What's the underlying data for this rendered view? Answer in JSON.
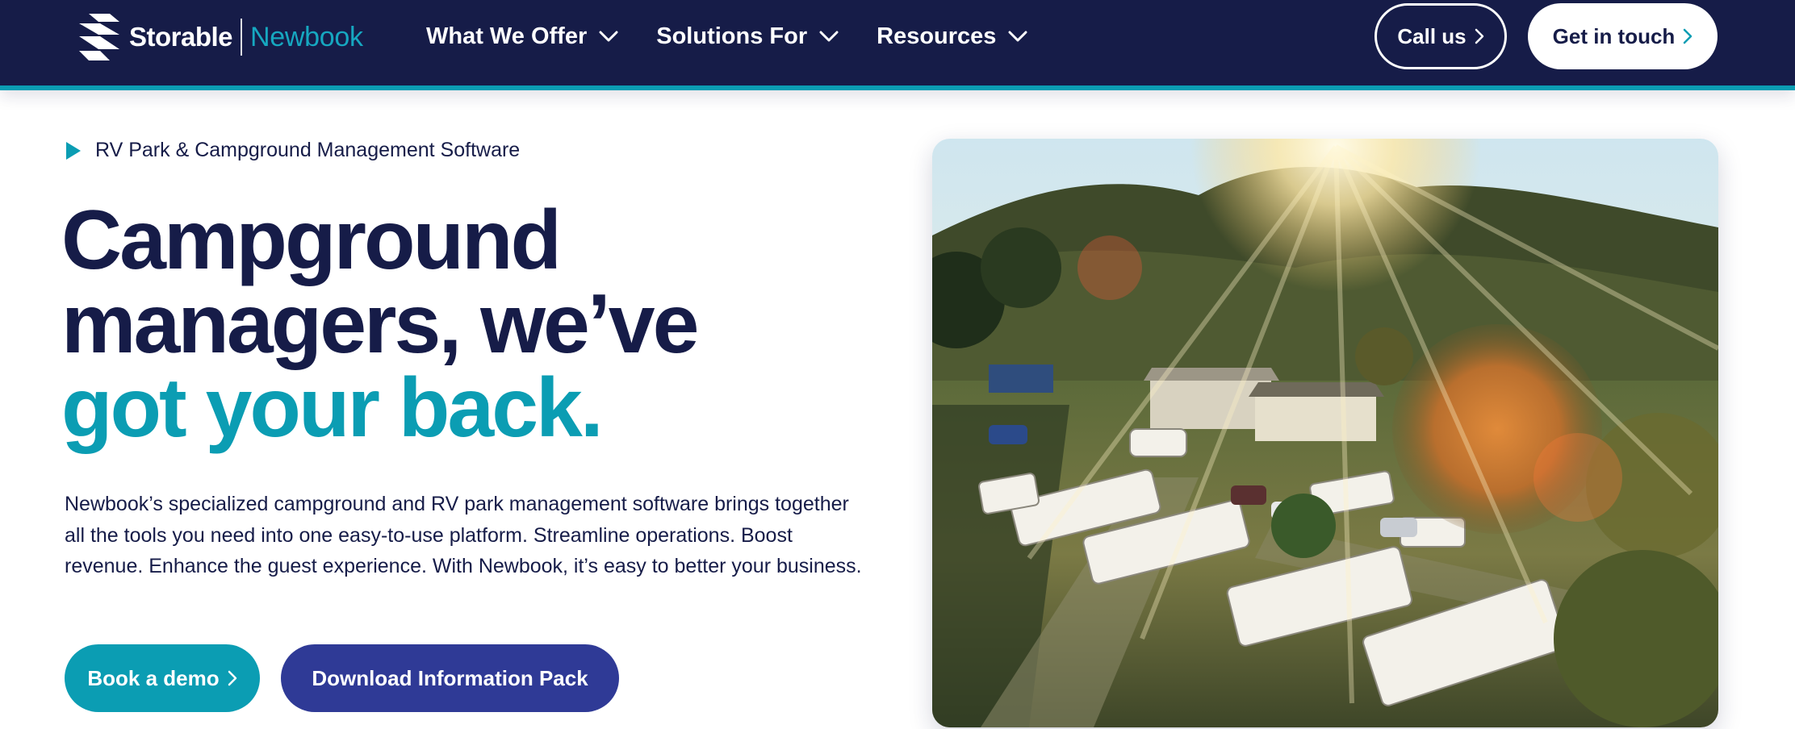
{
  "header": {
    "logo": {
      "brand": "Storable",
      "product": "Newbook",
      "icon": "storable-logo-icon"
    },
    "nav": [
      {
        "label": "What We Offer",
        "icon": "chevron-down-icon"
      },
      {
        "label": "Solutions For",
        "icon": "chevron-down-icon"
      },
      {
        "label": "Resources",
        "icon": "chevron-down-icon"
      }
    ],
    "call_button": {
      "label": "Call us",
      "icon": "chevron-right-icon"
    },
    "contact_button": {
      "label": "Get in touch",
      "icon": "chevron-right-icon"
    }
  },
  "hero": {
    "eyebrow": {
      "icon": "play-triangle-icon",
      "text": "RV Park & Campground Management Software"
    },
    "headline": {
      "line1": "Campground",
      "line2": "managers, we’ve",
      "line3_accent": "got your back."
    },
    "description": "Newbook’s specialized campground and RV park management software brings together all the tools you need into one easy-to-use platform. Streamline operations. Boost revenue. Enhance the guest experience. With Newbook, it’s easy to better your business.",
    "buttons": {
      "demo": {
        "label": "Book a demo",
        "icon": "chevron-right-icon"
      },
      "download": {
        "label": "Download Information Pack"
      }
    },
    "image": {
      "name": "campground-aerial-photo"
    }
  },
  "colors": {
    "navy": "#161c48",
    "teal": "#0b9db3",
    "indigo_button": "#2f3a96",
    "white": "#ffffff"
  }
}
